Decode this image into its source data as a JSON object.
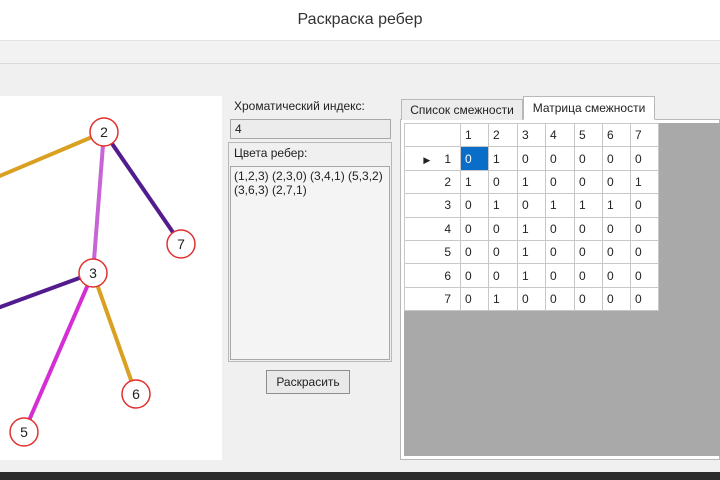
{
  "window": {
    "title": "Раскраска ребер"
  },
  "info": {
    "chromatic_label": "Хроматический индекс:",
    "chromatic_value": "4",
    "colors_label": "Цвета ребер:",
    "colors_value": "(1,2,3) (2,3,0) (3,4,1) (5,3,2) (3,6,3) (2,7,1)",
    "color_button": "Раскрасить"
  },
  "tabs": [
    {
      "label": "Список смежности",
      "active": false
    },
    {
      "label": "Матрица смежности",
      "active": true
    }
  ],
  "matrix": {
    "columns": [
      "1",
      "2",
      "3",
      "4",
      "5",
      "6",
      "7"
    ],
    "rows": [
      {
        "label": "1",
        "cells": [
          "0",
          "1",
          "0",
          "0",
          "0",
          "0",
          "0"
        ]
      },
      {
        "label": "2",
        "cells": [
          "1",
          "0",
          "1",
          "0",
          "0",
          "0",
          "1"
        ]
      },
      {
        "label": "3",
        "cells": [
          "0",
          "1",
          "0",
          "1",
          "1",
          "1",
          "0"
        ]
      },
      {
        "label": "4",
        "cells": [
          "0",
          "0",
          "1",
          "0",
          "0",
          "0",
          "0"
        ]
      },
      {
        "label": "5",
        "cells": [
          "0",
          "0",
          "1",
          "0",
          "0",
          "0",
          "0"
        ]
      },
      {
        "label": "6",
        "cells": [
          "0",
          "0",
          "1",
          "0",
          "0",
          "0",
          "0"
        ]
      },
      {
        "label": "7",
        "cells": [
          "0",
          "1",
          "0",
          "0",
          "0",
          "0",
          "0"
        ]
      }
    ]
  },
  "graph": {
    "nodes": [
      {
        "id": "2",
        "label": "2"
      },
      {
        "id": "3",
        "label": "3"
      },
      {
        "id": "5",
        "label": "5"
      },
      {
        "id": "6",
        "label": "6"
      },
      {
        "id": "7",
        "label": "7"
      }
    ],
    "edge_colors": {
      "0": "#c865d6",
      "1": "#521c8f",
      "2": "#d42ed4",
      "3": "#d9a021"
    },
    "node_border_color": "#e0312f"
  }
}
